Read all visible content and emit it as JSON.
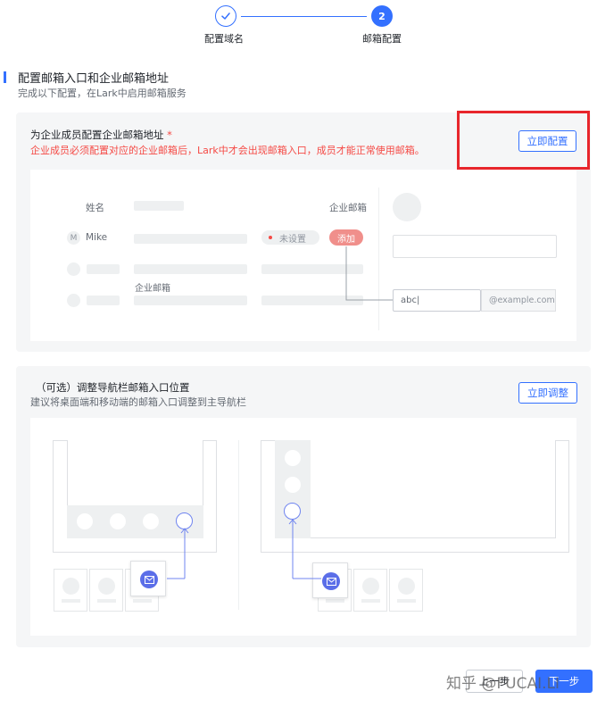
{
  "stepper": {
    "step1_label": "配置域名",
    "step2_number": "2",
    "step2_label": "邮箱配置"
  },
  "header": {
    "title": "配置邮箱入口和企业邮箱地址",
    "subtitle": "完成以下配置，在Lark中启用邮箱服务"
  },
  "section_address": {
    "title": "为企业成员配置企业邮箱地址",
    "required_mark": "*",
    "warning": "企业成员必须配置对应的企业邮箱后，Lark中才会出现邮箱入口，成员才能正常使用邮箱。",
    "button_label": "立即配置",
    "illustration": {
      "col_name": "姓名",
      "col_email": "企业邮箱",
      "member_initial": "M",
      "member_name": "Mike",
      "status_unset": "未设置",
      "add_label": "添加",
      "email_label": "企业邮箱",
      "input_value": "abc|",
      "domain_suffix": "@example.com"
    }
  },
  "section_nav": {
    "title": "（可选）调整导航栏邮箱入口位置",
    "description": "建议将桌面端和移动端的邮箱入口调整到主导航栏",
    "button_label": "立即调整"
  },
  "footer": {
    "prev_label": "上一步",
    "next_label": "下一步",
    "watermark": "知乎 @FUCAI.LI"
  },
  "colors": {
    "primary": "#3370ff",
    "danger": "#f54a45",
    "highlight_box": "#e8262c"
  }
}
